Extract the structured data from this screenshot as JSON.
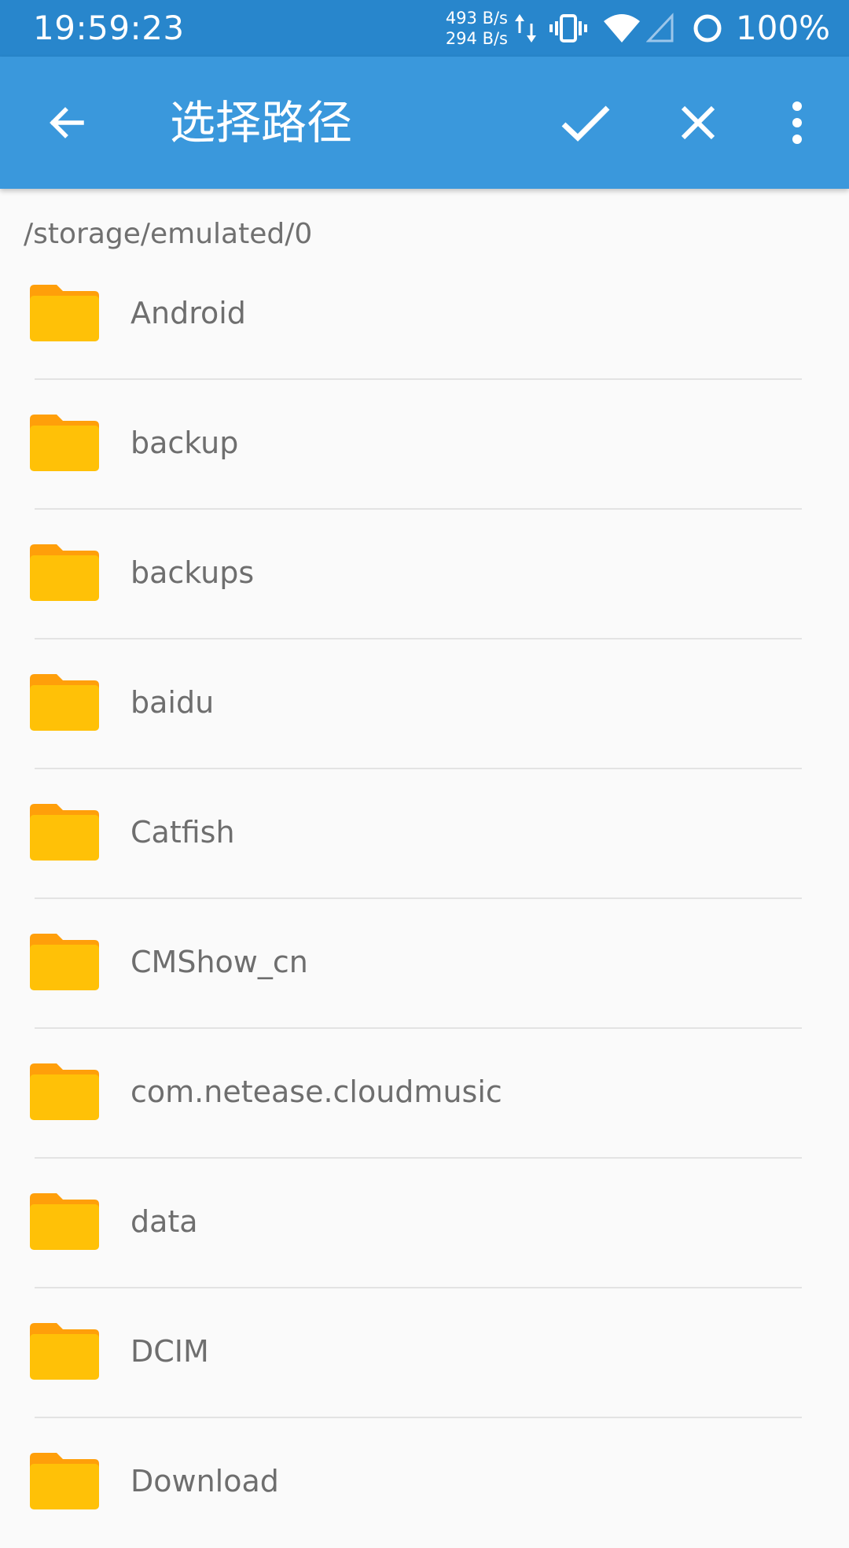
{
  "status_bar": {
    "time": "19:59:23",
    "upload_speed": "493 B/s",
    "download_speed": "294 B/s",
    "battery": "100%",
    "icons": [
      "data-arrows-icon",
      "vibrate-icon",
      "wifi-icon",
      "cell-signal-icon",
      "sync-icon"
    ]
  },
  "app_bar": {
    "title": "选择路径",
    "back_icon": "arrow-left-icon",
    "confirm_icon": "check-icon",
    "close_icon": "close-icon",
    "more_icon": "more-vert-icon",
    "background_color": "#3a98dc",
    "status_color": "#2886cc"
  },
  "current_path": "/storage/emulated/0",
  "folder_icon": "folder-icon",
  "folder_color": "#ffc107",
  "folder_tab_color": "#ff9f0a",
  "files": [
    {
      "name": "Android"
    },
    {
      "name": "backup"
    },
    {
      "name": "backups"
    },
    {
      "name": "baidu"
    },
    {
      "name": "Catfish"
    },
    {
      "name": "CMShow_cn"
    },
    {
      "name": "com.netease.cloudmusic"
    },
    {
      "name": "data"
    },
    {
      "name": "DCIM"
    },
    {
      "name": "Download"
    }
  ]
}
